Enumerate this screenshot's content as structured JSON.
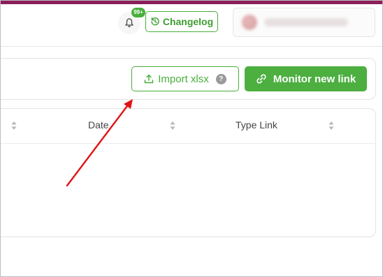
{
  "header": {
    "notification_count": "99+",
    "changelog_label": "Changelog"
  },
  "toolbar": {
    "import_label": "Import xlsx",
    "help_mark": "?",
    "monitor_label": "Monitor new link"
  },
  "table": {
    "columns": [
      "Date",
      "Type Link"
    ]
  },
  "colors": {
    "brand_strip": "#8a1e5a",
    "accent_green": "#48ae3a",
    "annotation_arrow": "#e01414"
  },
  "icons": {
    "bell": "bell-icon",
    "changelog": "history-clock-icon",
    "import": "upload-icon",
    "help": "help-circle-icon",
    "monitor": "link-icon",
    "sort": "sort-updown-icon"
  }
}
